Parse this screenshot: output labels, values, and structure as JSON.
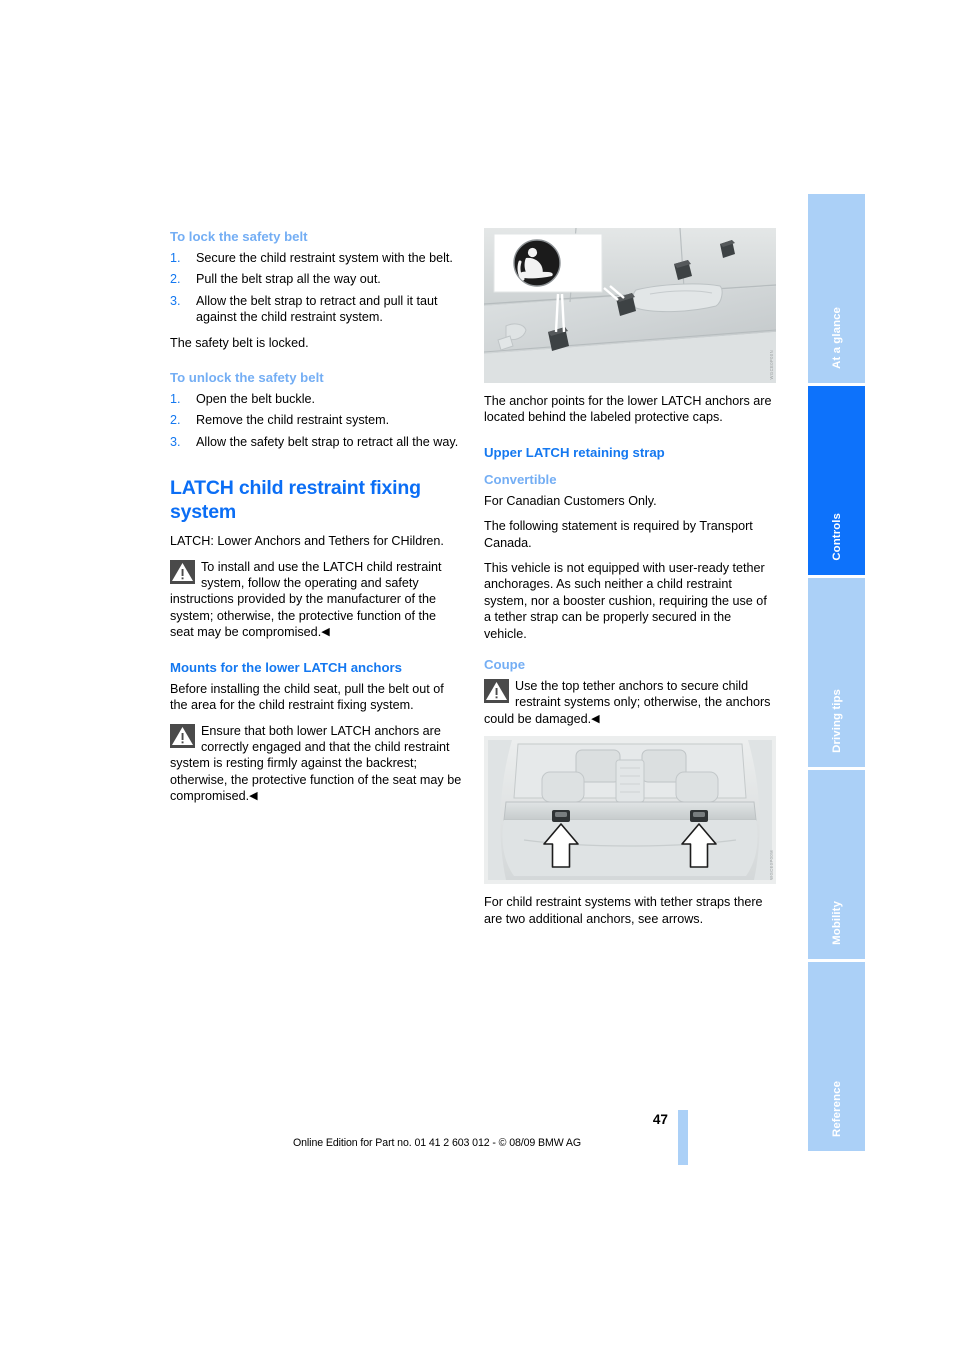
{
  "document": {
    "page_number": "47",
    "footer_legal": "Online Edition for Part no. 01 41 2 603 012 - © 08/09 BMW AG"
  },
  "left_column": {
    "lock_section": {
      "heading": "To lock the safety belt",
      "steps": [
        {
          "num": "1.",
          "text": "Secure the child restraint system with the belt."
        },
        {
          "num": "2.",
          "text": "Pull the belt strap all the way out."
        },
        {
          "num": "3.",
          "text": "Allow the belt strap to retract and pull it taut against the child restraint system."
        }
      ],
      "closing": "The safety belt is locked."
    },
    "unlock_section": {
      "heading": "To unlock the safety belt",
      "steps": [
        {
          "num": "1.",
          "text": "Open the belt buckle."
        },
        {
          "num": "2.",
          "text": "Remove the child restraint system."
        },
        {
          "num": "3.",
          "text": "Allow the safety belt strap to retract all the way."
        }
      ]
    },
    "latch_section": {
      "title": "LATCH child restraint fixing system",
      "intro": "LATCH: Lower Anchors and Tethers for CHildren.",
      "warning": "To install and use the LATCH child restraint system, follow the operating and safety instructions provided by the manufacturer of the system; otherwise, the protective function of the seat may be compromised.",
      "warning_endmark": "◀"
    },
    "mounts_section": {
      "heading": "Mounts for the lower LATCH anchors",
      "text": "Before installing the child seat, pull the belt out of the area for the child restraint fixing system.",
      "warning": "Ensure that both lower LATCH anchors are correctly engaged and that the child restraint system is resting firmly against the backrest; otherwise, the protective function of the seat may be compromised.",
      "warning_endmark": "◀"
    }
  },
  "right_column": {
    "figure_anchors": {
      "alt": "Rear seat bench showing lower LATCH anchor points behind labeled protective caps",
      "image_code": "WGCE0P00N",
      "caption": "The anchor points for the lower LATCH anchors are located behind the labeled protective caps."
    },
    "upper_strap_section": {
      "heading": "Upper LATCH retaining strap",
      "convertible": {
        "heading": "Convertible",
        "paragraphs": [
          "For Canadian Customers Only.",
          "The following statement is required by Transport Canada.",
          "This vehicle is not equipped with user-ready tether anchorages. As such neither a child restraint system, nor a booster cushion, requiring the use of a tether strap can be properly secured in the vehicle."
        ]
      },
      "coupe": {
        "heading": "Coupe",
        "warning": "Use the top tether anchors to secure child restraint systems only; otherwise, the anchors could be damaged.",
        "warning_endmark": "◀"
      }
    },
    "figure_tether": {
      "alt": "Rear cargo area with two top tether anchors marked by white arrows",
      "image_code": "WGCE0P00M",
      "caption": "For child restraint systems with tether straps there are two additional anchors, see arrows."
    }
  },
  "side_tabs": [
    {
      "label": "At a glance",
      "active": false
    },
    {
      "label": "Controls",
      "active": true
    },
    {
      "label": "Driving tips",
      "active": false
    },
    {
      "label": "Mobility",
      "active": false
    },
    {
      "label": "Reference",
      "active": false
    }
  ],
  "colors": {
    "heading_blue": "#0b6ef5",
    "subheading_blue": "#1478f0",
    "light_blue": "#74aef4",
    "tab_inactive": "#abd0f7",
    "tab_active": "#0d72fb"
  }
}
